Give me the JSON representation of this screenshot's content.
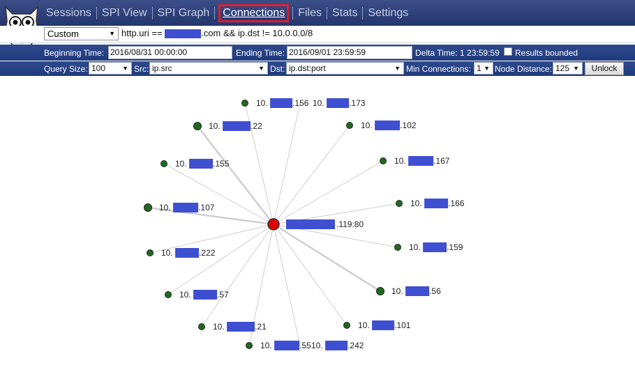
{
  "nav": {
    "items": [
      {
        "id": "sessions",
        "label": "Sessions"
      },
      {
        "id": "spiview",
        "label": "SPI View"
      },
      {
        "id": "spigraph",
        "label": "SPI Graph"
      },
      {
        "id": "connections",
        "label": "Connections",
        "active": true
      },
      {
        "id": "files",
        "label": "Files"
      },
      {
        "id": "stats",
        "label": "Stats"
      },
      {
        "id": "settings",
        "label": "Settings"
      }
    ]
  },
  "query": {
    "expr_select": "Custom",
    "expr_pre": "http.uri ==",
    "expr_post": ".com && ip.dst != 10.0.0.0/8"
  },
  "time": {
    "begin_label": "Beginning Time:",
    "begin_value": "2016/08/31 00:00:00",
    "end_label": "Ending Time:",
    "end_value": "2016/09/01 23:59:59",
    "delta_label": "Delta Time: 1 23:59:59",
    "bounded_label": "Results bounded"
  },
  "options": {
    "query_size_label": "Query Size:",
    "query_size": "100",
    "src_label": "Src:",
    "src": "ip.src",
    "dst_label": "Dst:",
    "dst": "ip.dst:port",
    "min_conn_label": "Min Connections:",
    "min_conn": "1",
    "node_dist_label": "Node Distance:",
    "node_dist": "125",
    "unlock_label": "Unlock"
  },
  "graph": {
    "center": {
      "prefix": "",
      "suffix": ".119:80",
      "color": "#e00000"
    },
    "node_color": "#1e6b1e",
    "redact_color": "#3f4fd1",
    "nodes": [
      {
        "prefix": "10.",
        "suffix": ".156"
      },
      {
        "prefix": "10.",
        "suffix": ".173"
      },
      {
        "prefix": "10.",
        "suffix": ".22"
      },
      {
        "prefix": "10.",
        "suffix": ".102"
      },
      {
        "prefix": "10.",
        "suffix": ".155"
      },
      {
        "prefix": "10.",
        "suffix": ".167"
      },
      {
        "prefix": "10.",
        "suffix": ".107"
      },
      {
        "prefix": "10.",
        "suffix": ".166"
      },
      {
        "prefix": "10.",
        "suffix": ".222"
      },
      {
        "prefix": "10.",
        "suffix": ".159"
      },
      {
        "prefix": "10.",
        "suffix": ".56"
      },
      {
        "prefix": "10.",
        "suffix": ".57"
      },
      {
        "prefix": "10.",
        "suffix": ".101"
      },
      {
        "prefix": "10.",
        "suffix": ".21"
      },
      {
        "prefix": "10.",
        "suffix": ".55"
      },
      {
        "prefix": "10.",
        "suffix": ".242"
      }
    ]
  }
}
